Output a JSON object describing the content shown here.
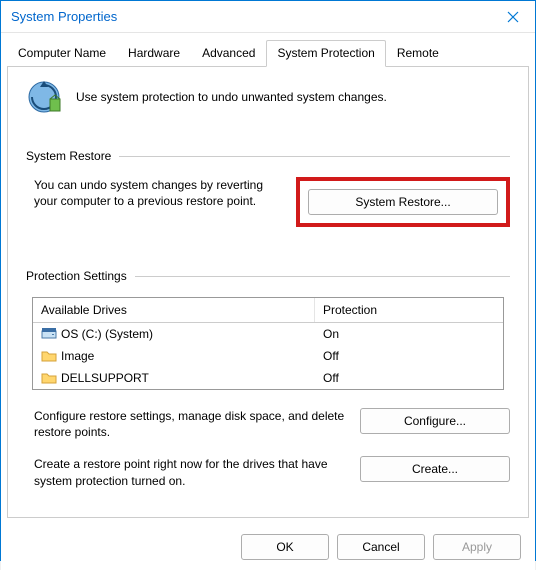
{
  "window": {
    "title": "System Properties"
  },
  "tabs": {
    "items": [
      {
        "label": "Computer Name"
      },
      {
        "label": "Hardware"
      },
      {
        "label": "Advanced"
      },
      {
        "label": "System Protection"
      },
      {
        "label": "Remote"
      }
    ],
    "activeIndex": 3
  },
  "header": {
    "text": "Use system protection to undo unwanted system changes."
  },
  "restore": {
    "group_label": "System Restore",
    "description": "You can undo system changes by reverting your computer to a previous restore point.",
    "button": "System Restore..."
  },
  "protection": {
    "group_label": "Protection Settings",
    "columns": {
      "drive": "Available Drives",
      "status": "Protection"
    },
    "rows": [
      {
        "icon": "drive",
        "name": "OS (C:) (System)",
        "status": "On"
      },
      {
        "icon": "folder",
        "name": "Image",
        "status": "Off"
      },
      {
        "icon": "folder",
        "name": "DELLSUPPORT",
        "status": "Off"
      }
    ],
    "configure_text": "Configure restore settings, manage disk space, and delete restore points.",
    "configure_button": "Configure...",
    "create_text": "Create a restore point right now for the drives that have system protection turned on.",
    "create_button": "Create..."
  },
  "footer": {
    "ok": "OK",
    "cancel": "Cancel",
    "apply": "Apply"
  }
}
